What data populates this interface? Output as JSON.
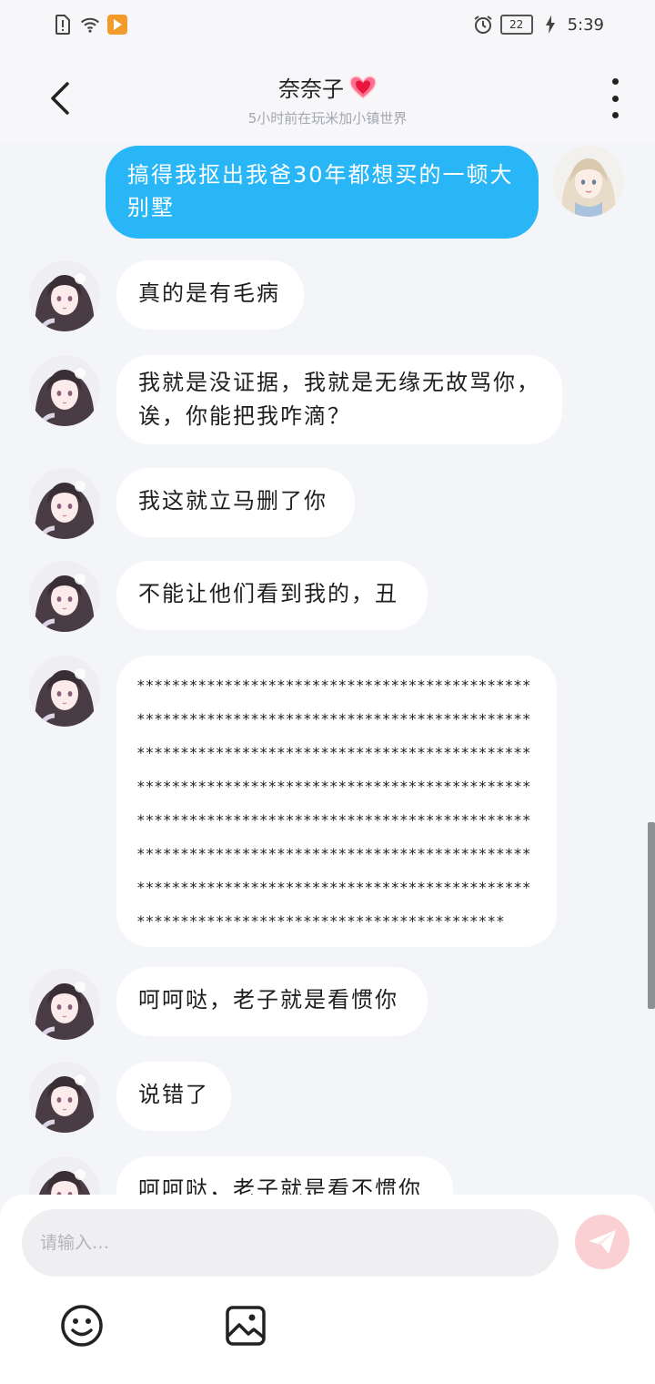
{
  "status_bar": {
    "battery": "22",
    "time": "5:39",
    "icons": [
      "sim-alert-icon",
      "wifi-icon",
      "app-notification-icon",
      "alarm-icon",
      "charging-icon"
    ]
  },
  "header": {
    "title": "奈奈子",
    "subtitle": "5小时前在玩米加小镇世界",
    "title_emoji": "heart-icon"
  },
  "messages": [
    {
      "side": "right",
      "text": "搞得我抠出我爸30年都想买的一顿大别墅"
    },
    {
      "side": "left",
      "text": "真的是有毛病"
    },
    {
      "side": "left",
      "text": "我就是没证据，我就是无缘无故骂你，诶，你能把我咋滴？"
    },
    {
      "side": "left",
      "text": "我这就立马删了你"
    },
    {
      "side": "left",
      "text": "不能让他们看到我的，丑"
    },
    {
      "side": "left",
      "text": "*********************************************************************************************************************************************************************************************************************************************************************************************************************************************************************"
    },
    {
      "side": "left",
      "text": "呵呵哒，老子就是看惯你"
    },
    {
      "side": "left",
      "text": "说错了"
    },
    {
      "side": "left",
      "text": "呵呵哒，老子就是看不惯你"
    }
  ],
  "input": {
    "placeholder": "请输入…"
  },
  "colors": {
    "my_bubble": "#29b6f6",
    "their_bubble": "#ffffff",
    "background": "#f4f5f9",
    "send_button": "#fbd0d3"
  }
}
